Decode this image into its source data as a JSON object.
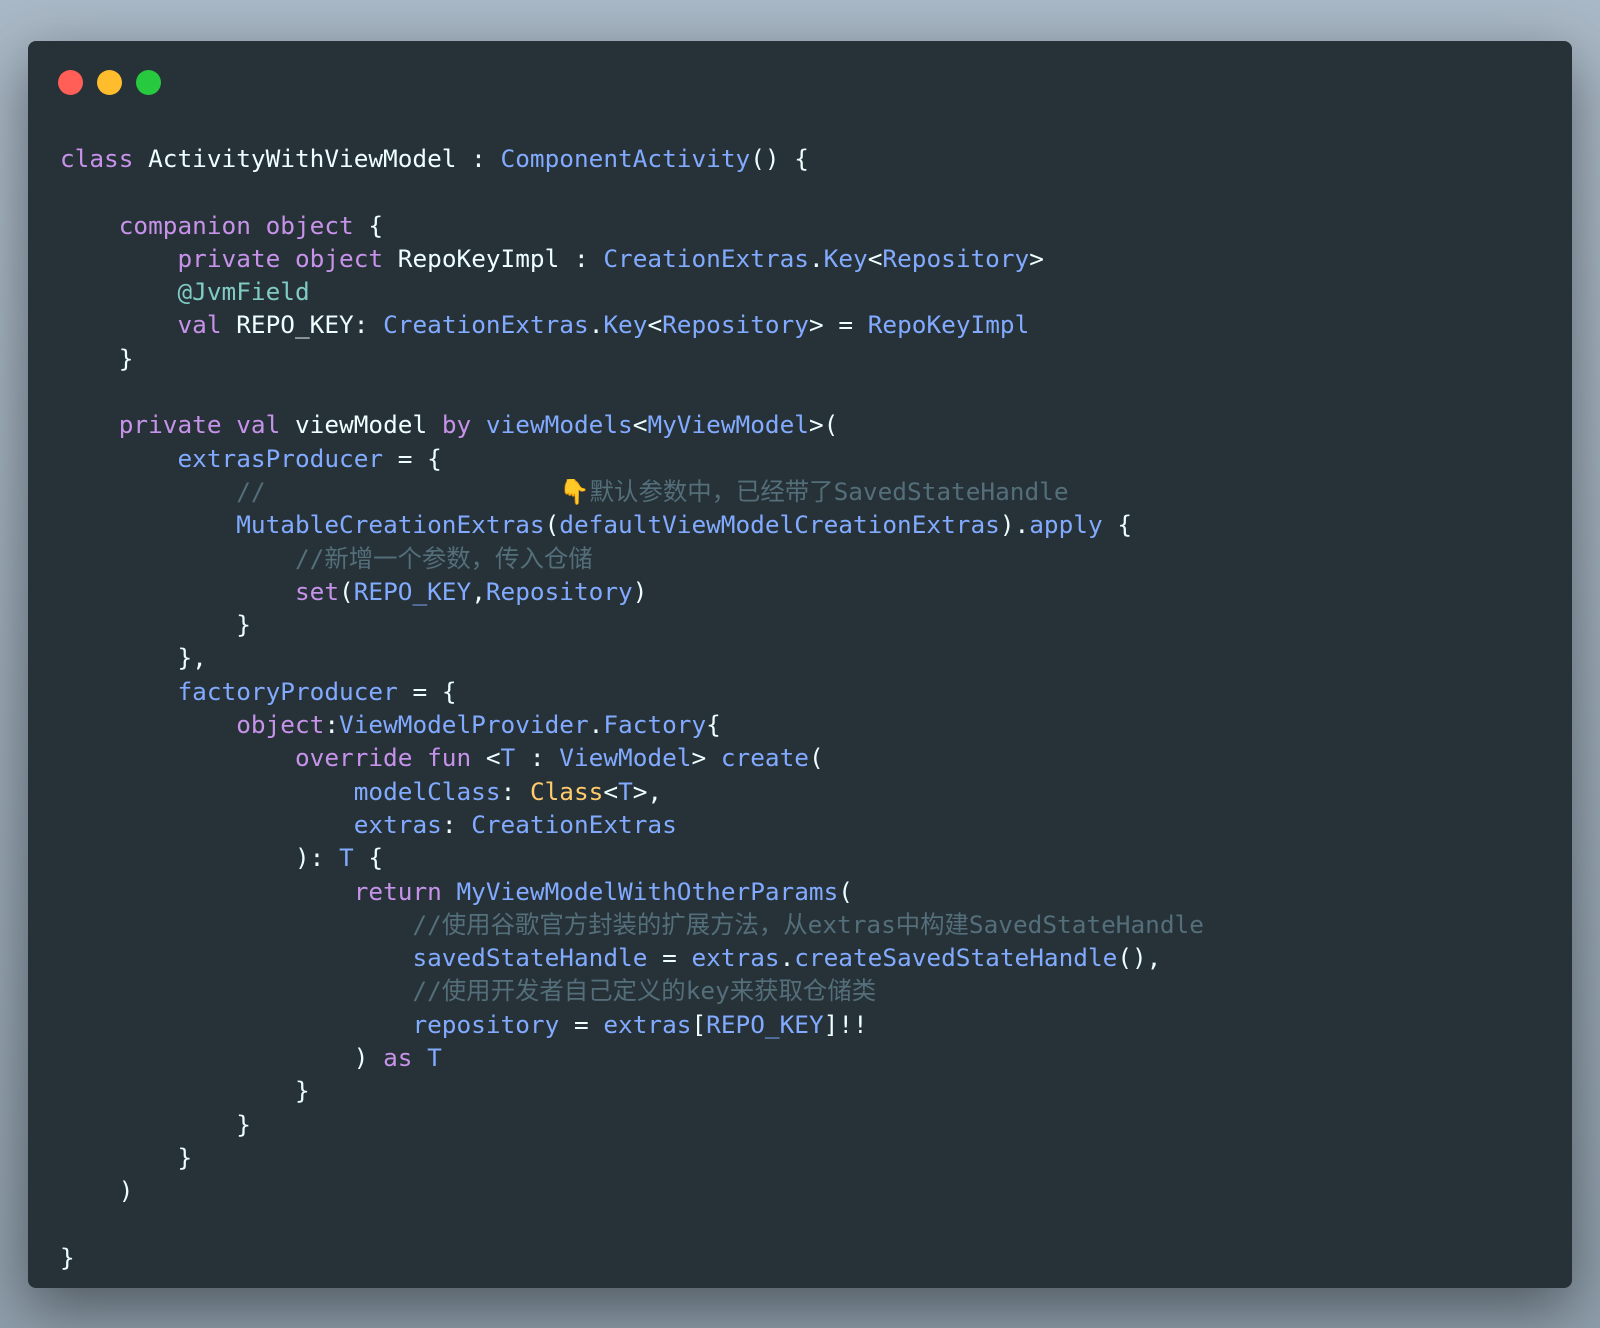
{
  "window": {
    "controls": [
      {
        "name": "close-button",
        "color": "#ff5f56"
      },
      {
        "name": "minimize-button",
        "color": "#ffbd2e"
      },
      {
        "name": "maximize-button",
        "color": "#27c93f"
      }
    ],
    "background": "#263238"
  },
  "syntax_colors": {
    "k": "#c792ea",
    "t": "#82aaff",
    "p": "#eeffff",
    "c": "#546e7a",
    "a": "#80cbc4",
    "y": "#ffcb6b"
  },
  "code_lines": [
    [
      [
        "class ",
        "k"
      ],
      [
        "ActivityWithViewModel : ",
        "p"
      ],
      [
        "ComponentActivity",
        "t"
      ],
      [
        "() {",
        "p"
      ]
    ],
    [],
    [
      [
        "    ",
        "p"
      ],
      [
        "companion object",
        "k"
      ],
      [
        " {",
        "p"
      ]
    ],
    [
      [
        "        ",
        "p"
      ],
      [
        "private object ",
        "k"
      ],
      [
        "RepoKeyImpl : ",
        "p"
      ],
      [
        "CreationExtras",
        "t"
      ],
      [
        ".",
        "p"
      ],
      [
        "Key",
        "t"
      ],
      [
        "<",
        "p"
      ],
      [
        "Repository",
        "t"
      ],
      [
        ">",
        "p"
      ]
    ],
    [
      [
        "        ",
        "p"
      ],
      [
        "@JvmField",
        "a"
      ]
    ],
    [
      [
        "        ",
        "p"
      ],
      [
        "val ",
        "k"
      ],
      [
        "REPO_KEY: ",
        "p"
      ],
      [
        "CreationExtras",
        "t"
      ],
      [
        ".",
        "p"
      ],
      [
        "Key",
        "t"
      ],
      [
        "<",
        "p"
      ],
      [
        "Repository",
        "t"
      ],
      [
        "> = ",
        "p"
      ],
      [
        "RepoKeyImpl",
        "t"
      ]
    ],
    [
      [
        "    }",
        "p"
      ]
    ],
    [],
    [
      [
        "    ",
        "p"
      ],
      [
        "private val ",
        "k"
      ],
      [
        "viewModel ",
        "p"
      ],
      [
        "by ",
        "k"
      ],
      [
        "viewModels",
        "t"
      ],
      [
        "<",
        "p"
      ],
      [
        "MyViewModel",
        "t"
      ],
      [
        ">(",
        "p"
      ]
    ],
    [
      [
        "        ",
        "p"
      ],
      [
        "extrasProducer",
        "t"
      ],
      [
        " = {",
        "p"
      ]
    ],
    [
      [
        "            //                    ",
        "c"
      ],
      [
        "👇",
        "y"
      ],
      [
        "默认参数中，已经带了SavedStateHandle",
        "c"
      ]
    ],
    [
      [
        "            ",
        "p"
      ],
      [
        "MutableCreationExtras",
        "t"
      ],
      [
        "(",
        "p"
      ],
      [
        "defaultViewModelCreationExtras",
        "t"
      ],
      [
        ").",
        "p"
      ],
      [
        "apply",
        "t"
      ],
      [
        " {",
        "p"
      ]
    ],
    [
      [
        "                //新增一个参数，传入仓储",
        "c"
      ]
    ],
    [
      [
        "                ",
        "p"
      ],
      [
        "set",
        "k"
      ],
      [
        "(",
        "p"
      ],
      [
        "REPO_KEY",
        "t"
      ],
      [
        ",",
        "p"
      ],
      [
        "Repository",
        "t"
      ],
      [
        ")",
        "p"
      ]
    ],
    [
      [
        "            }",
        "p"
      ]
    ],
    [
      [
        "        },",
        "p"
      ]
    ],
    [
      [
        "        ",
        "p"
      ],
      [
        "factoryProducer",
        "t"
      ],
      [
        " = {",
        "p"
      ]
    ],
    [
      [
        "            ",
        "p"
      ],
      [
        "object",
        "k"
      ],
      [
        ":",
        "p"
      ],
      [
        "ViewModelProvider",
        "t"
      ],
      [
        ".",
        "p"
      ],
      [
        "Factory",
        "t"
      ],
      [
        "{",
        "p"
      ]
    ],
    [
      [
        "                ",
        "p"
      ],
      [
        "override fun ",
        "k"
      ],
      [
        "<",
        "p"
      ],
      [
        "T",
        "t"
      ],
      [
        " : ",
        "p"
      ],
      [
        "ViewModel",
        "t"
      ],
      [
        "> ",
        "p"
      ],
      [
        "create",
        "t"
      ],
      [
        "(",
        "p"
      ]
    ],
    [
      [
        "                    ",
        "p"
      ],
      [
        "modelClass",
        "t"
      ],
      [
        ": ",
        "p"
      ],
      [
        "Class",
        "y"
      ],
      [
        "<",
        "p"
      ],
      [
        "T",
        "t"
      ],
      [
        ">,",
        "p"
      ]
    ],
    [
      [
        "                    ",
        "p"
      ],
      [
        "extras",
        "t"
      ],
      [
        ": ",
        "p"
      ],
      [
        "CreationExtras",
        "t"
      ]
    ],
    [
      [
        "                ): ",
        "p"
      ],
      [
        "T",
        "t"
      ],
      [
        " {",
        "p"
      ]
    ],
    [
      [
        "                    ",
        "p"
      ],
      [
        "return ",
        "k"
      ],
      [
        "MyViewModelWithOtherParams",
        "t"
      ],
      [
        "(",
        "p"
      ]
    ],
    [
      [
        "                        //使用谷歌官方封装的扩展方法，从extras中构建SavedStateHandle",
        "c"
      ]
    ],
    [
      [
        "                        ",
        "p"
      ],
      [
        "savedStateHandle",
        "t"
      ],
      [
        " = ",
        "p"
      ],
      [
        "extras",
        "t"
      ],
      [
        ".",
        "p"
      ],
      [
        "createSavedStateHandle",
        "t"
      ],
      [
        "(),",
        "p"
      ]
    ],
    [
      [
        "                        //使用开发者自己定义的key来获取仓储类",
        "c"
      ]
    ],
    [
      [
        "                        ",
        "p"
      ],
      [
        "repository",
        "t"
      ],
      [
        " = ",
        "p"
      ],
      [
        "extras",
        "t"
      ],
      [
        "[",
        "p"
      ],
      [
        "REPO_KEY",
        "t"
      ],
      [
        "]!!",
        "p"
      ]
    ],
    [
      [
        "                    ) ",
        "p"
      ],
      [
        "as ",
        "k"
      ],
      [
        "T",
        "t"
      ]
    ],
    [
      [
        "                }",
        "p"
      ]
    ],
    [
      [
        "            }",
        "p"
      ]
    ],
    [
      [
        "        }",
        "p"
      ]
    ],
    [
      [
        "    )",
        "p"
      ]
    ],
    [],
    [
      [
        "}",
        "p"
      ]
    ]
  ]
}
